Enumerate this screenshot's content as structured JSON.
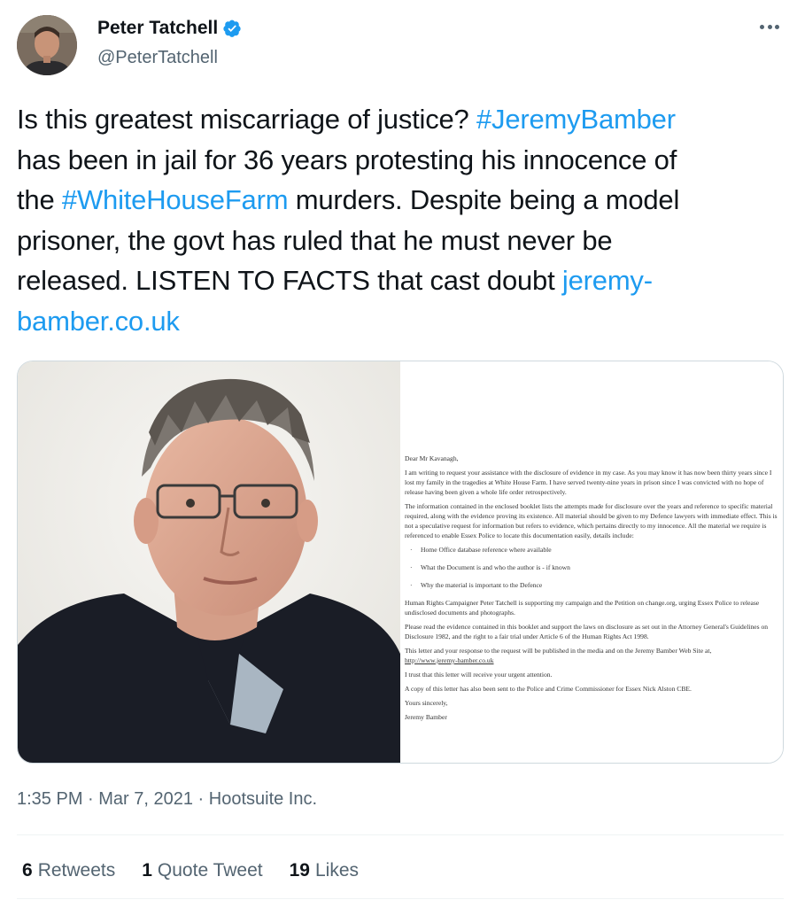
{
  "author": {
    "name": "Peter Tatchell",
    "handle": "@PeterTatchell",
    "verified_icon": "verified-badge-icon",
    "more_icon": "more-options-icon"
  },
  "tweet": {
    "line1_pre": "Is this greatest miscarriage of justice? ",
    "hashtag1": "#JeremyBamber",
    "line2": "has been in jail for 36 years protesting his innocence of",
    "line3_pre": "the ",
    "hashtag2": "#WhiteHouseFarm",
    "line3_post": " murders. Despite being a model",
    "line4": "prisoner, the govt has ruled that he must never be",
    "line5_pre": "released. LISTEN TO FACTS that cast doubt ",
    "link_part1": "jeremy-",
    "link_part2": "bamber.co.uk"
  },
  "letter": {
    "salutation": "Dear Mr Kavanagh,",
    "p1": "I am writing to request your assistance with the disclosure of evidence in my case. As you may know it has now been thirty years since I lost my family in the tragedies at White House Farm. I have served twenty-nine years in prison since I was convicted with no hope of release having been given a whole life order retrospectively.",
    "p2": "The information contained in the enclosed booklet lists the attempts made for disclosure over the years and reference to specific material required, along with the evidence proving its existence. All material should be given to my Defence lawyers with immediate effect. This is not a speculative request for information but refers to evidence, which pertains directly to my innocence. All the material we require is referenced to enable Essex Police to locate this documentation easily, details include:",
    "bullets": [
      "Home Office database reference where available",
      "What the Document is and who the author is - if known",
      "Why the material is important to the Defence"
    ],
    "p3": "Human Rights Campaigner Peter Tatchell is supporting my campaign and the Petition on change.org, urging Essex Police to release undisclosed documents and photographs.",
    "p4": "Please read the evidence contained in this booklet and support the laws on disclosure as set out in the Attorney General's Guidelines on Disclosure 1982, and the right to a fair trial under Article 6 of the Human Rights Act 1998.",
    "p5": "This letter and your response to the request will be published in the media and on the Jeremy Bamber Web Site at,",
    "p5_link": "http://www.jeremy-bamber.co.uk",
    "p6": "I trust that this letter will receive your urgent attention.",
    "p7": "A copy of this letter has also been sent to the Police and Crime Commissioner for Essex Nick Alston CBE.",
    "closing": "Yours sincerely,",
    "signature": "Jeremy Bamber"
  },
  "meta": {
    "timestamp": "1:35 PM · Mar 7, 2021 · Hootsuite Inc."
  },
  "stats": {
    "retweets_count": "6",
    "retweets_label": "Retweets",
    "quotes_count": "1",
    "quotes_label": "Quote Tweet",
    "likes_count": "19",
    "likes_label": "Likes"
  },
  "colors": {
    "link": "#1d9bf0",
    "text": "#0f1419",
    "secondary": "#536471",
    "border": "#cfd9de"
  }
}
